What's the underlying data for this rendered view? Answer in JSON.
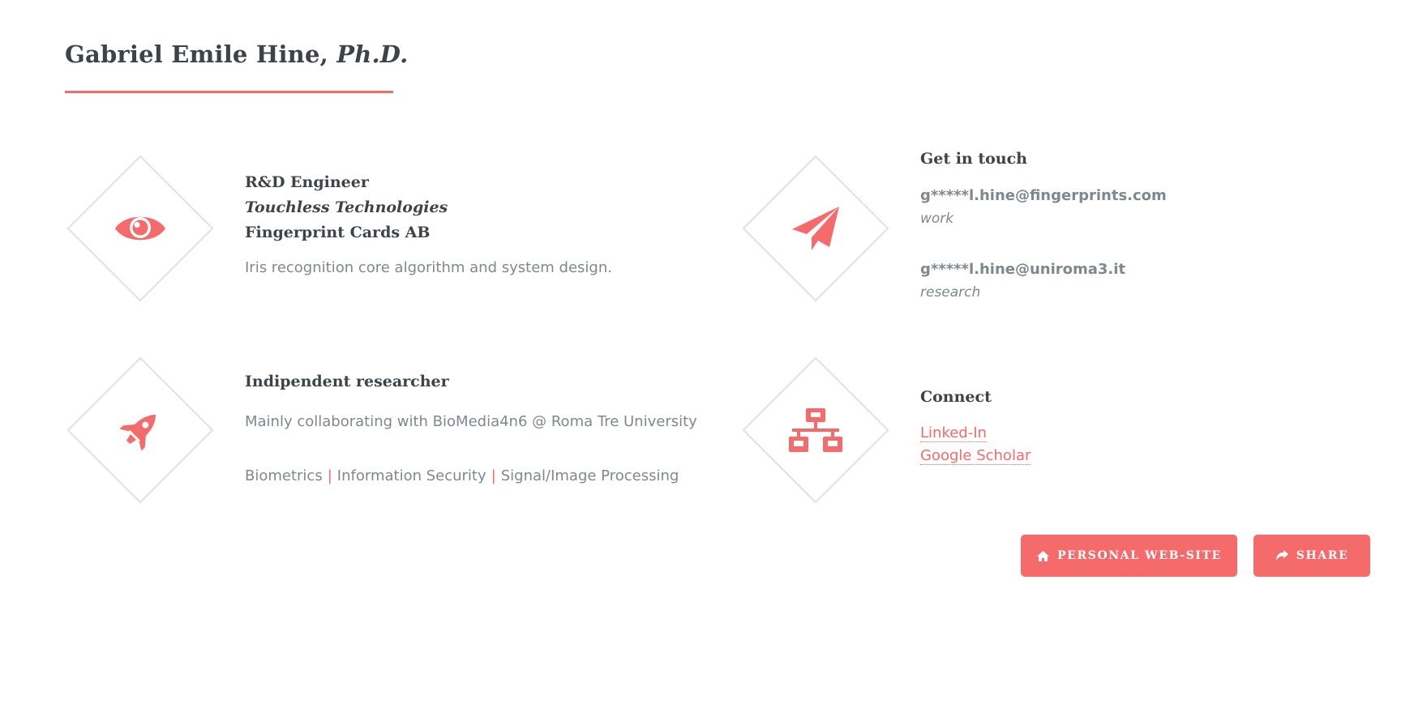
{
  "header": {
    "name": "Gabriel Emile Hine,",
    "degree": "Ph.D."
  },
  "job": {
    "icon": "eye-icon",
    "role": "R&D Engineer",
    "team": "Touchless Technologies",
    "company": "Fingerprint Cards AB",
    "description": "Iris recognition core algorithm and system design."
  },
  "research": {
    "icon": "rocket-icon",
    "title": "Indipendent researcher",
    "description": "Mainly collaborating with BioMedia4n6 @ Roma Tre University",
    "topics": [
      "Biometrics",
      "Information Security",
      "Signal/Image Processing"
    ],
    "separator": "|"
  },
  "contact": {
    "icon": "paper-plane-icon",
    "title": "Get in touch",
    "emails": [
      {
        "address": "g*****l.hine@fingerprints.com",
        "kind": "work"
      },
      {
        "address": "g*****l.hine@uniroma3.it",
        "kind": "research"
      }
    ]
  },
  "connect": {
    "icon": "network-icon",
    "title": "Connect",
    "links": [
      "Linked-In",
      "Google Scholar"
    ]
  },
  "actions": {
    "website_label": "PERSONAL WEB-SITE",
    "website_icon": "home-icon",
    "share_label": "SHARE",
    "share_icon": "share-icon"
  },
  "colors": {
    "accent": "#f56a6a",
    "heading": "#3d4449",
    "text": "#7f888f",
    "diamond_border": "#e1e1e1"
  }
}
